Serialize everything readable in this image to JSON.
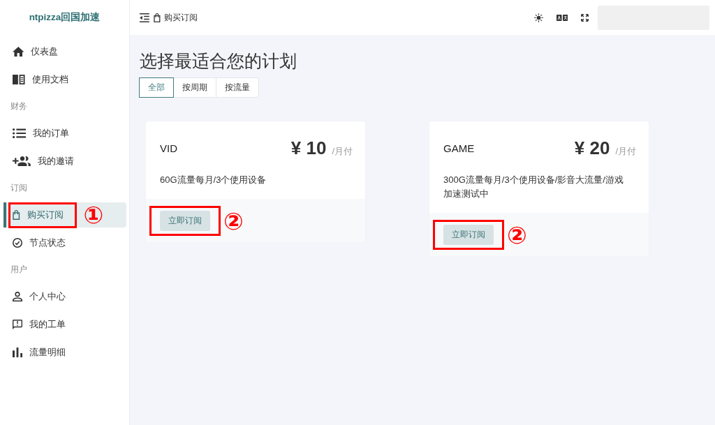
{
  "sidebar": {
    "logo": "ntpizza回国加速",
    "groups": [
      {
        "items": [
          {
            "label": "仪表盘",
            "selected": false
          },
          {
            "label": "使用文档",
            "selected": false
          }
        ]
      },
      {
        "heading": "财务",
        "items": [
          {
            "label": "我的订单",
            "selected": false
          },
          {
            "label": "我的邀请",
            "selected": false
          }
        ]
      },
      {
        "heading": "订阅",
        "items": [
          {
            "label": "购买订阅",
            "selected": true,
            "callout": "①"
          },
          {
            "label": "节点状态",
            "selected": false
          }
        ]
      },
      {
        "heading": "用户",
        "items": [
          {
            "label": "个人中心",
            "selected": false
          },
          {
            "label": "我的工单",
            "selected": false
          },
          {
            "label": "流量明细",
            "selected": false
          }
        ]
      }
    ]
  },
  "top_bar": {
    "breadcrumb": "购买订阅"
  },
  "page_title": "选择最适合您的计划",
  "tabs": [
    {
      "label": "全部",
      "selected": true
    },
    {
      "label": "按周期",
      "selected": false
    },
    {
      "label": "按流量",
      "selected": false
    }
  ],
  "plans": [
    {
      "name": "VID",
      "price": "¥ 10",
      "period": "/月付",
      "description": "60G流量每月/3个使用设备",
      "button": "立即订阅",
      "callout": "②"
    },
    {
      "name": "GAME",
      "price": "¥ 20",
      "period": "/月付",
      "description": "300G流量每月/3个使用设备/影音大流量/游戏加速测试中",
      "button": "立即订阅",
      "callout": "②"
    }
  ]
}
